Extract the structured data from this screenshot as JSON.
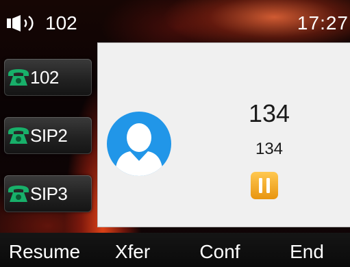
{
  "status_bar": {
    "speaker_icon": "speaker-icon",
    "account": "102",
    "time": "17:27"
  },
  "line_keys": [
    {
      "label": "102",
      "icon": "phone-icon",
      "color": "#18b06a"
    },
    {
      "label": "SIP2",
      "icon": "phone-icon",
      "color": "#18b06a"
    },
    {
      "label": "SIP3",
      "icon": "phone-icon",
      "color": "#18b06a"
    }
  ],
  "call": {
    "name": "134",
    "number": "134",
    "avatar_icon": "contact-avatar-icon",
    "hold_icon": "pause-icon",
    "avatar_color": "#2196e8",
    "hold_color": "#f0a818"
  },
  "softkeys": [
    "Resume",
    "Xfer",
    "Conf",
    "End"
  ]
}
